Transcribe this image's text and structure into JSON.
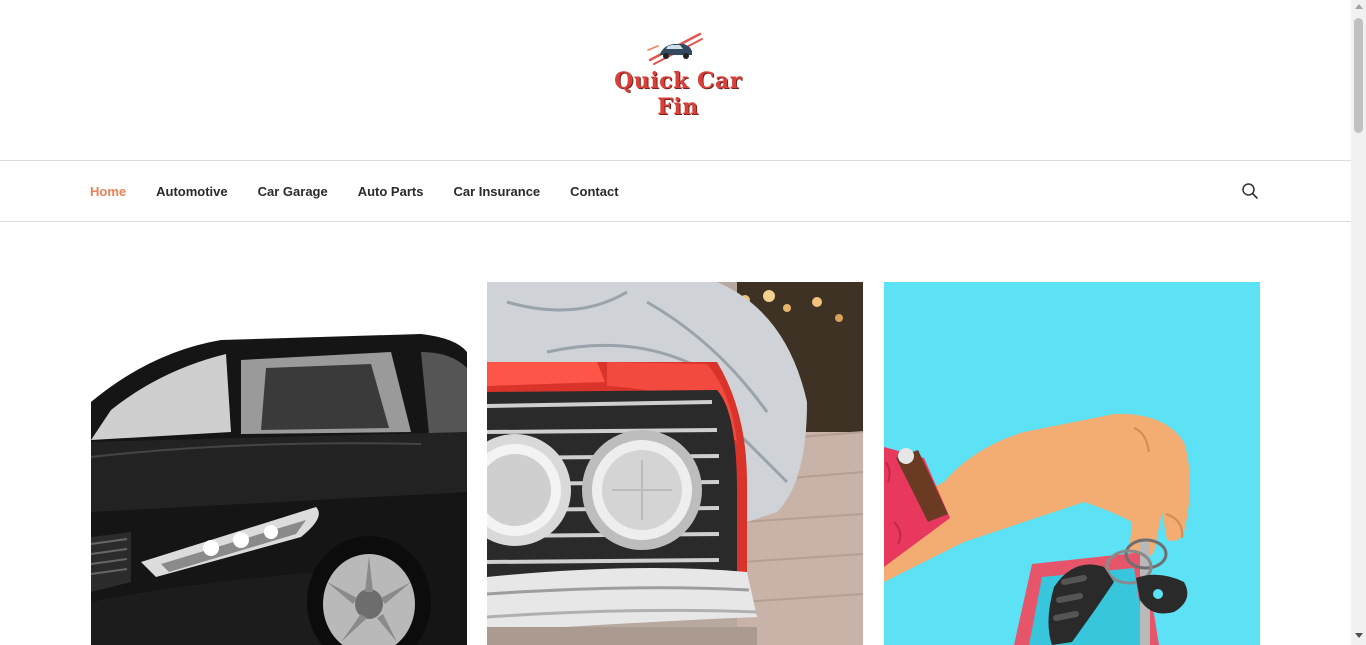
{
  "site": {
    "title": "Quick Car Fin",
    "logo_icon": "car-logo-icon",
    "brand_color": "#d8403a"
  },
  "nav": {
    "items": [
      {
        "label": "Home",
        "active": true
      },
      {
        "label": "Automotive",
        "active": false
      },
      {
        "label": "Car Garage",
        "active": false
      },
      {
        "label": "Auto Parts",
        "active": false
      },
      {
        "label": "Car Insurance",
        "active": false
      },
      {
        "label": "Contact",
        "active": false
      }
    ],
    "active_color": "#f07f55",
    "search_icon": "search-icon"
  },
  "cards": [
    {
      "image": "black-sedan-image"
    },
    {
      "image": "vintage-red-car-headlights-image"
    },
    {
      "image": "hand-holding-car-keys-image"
    }
  ]
}
